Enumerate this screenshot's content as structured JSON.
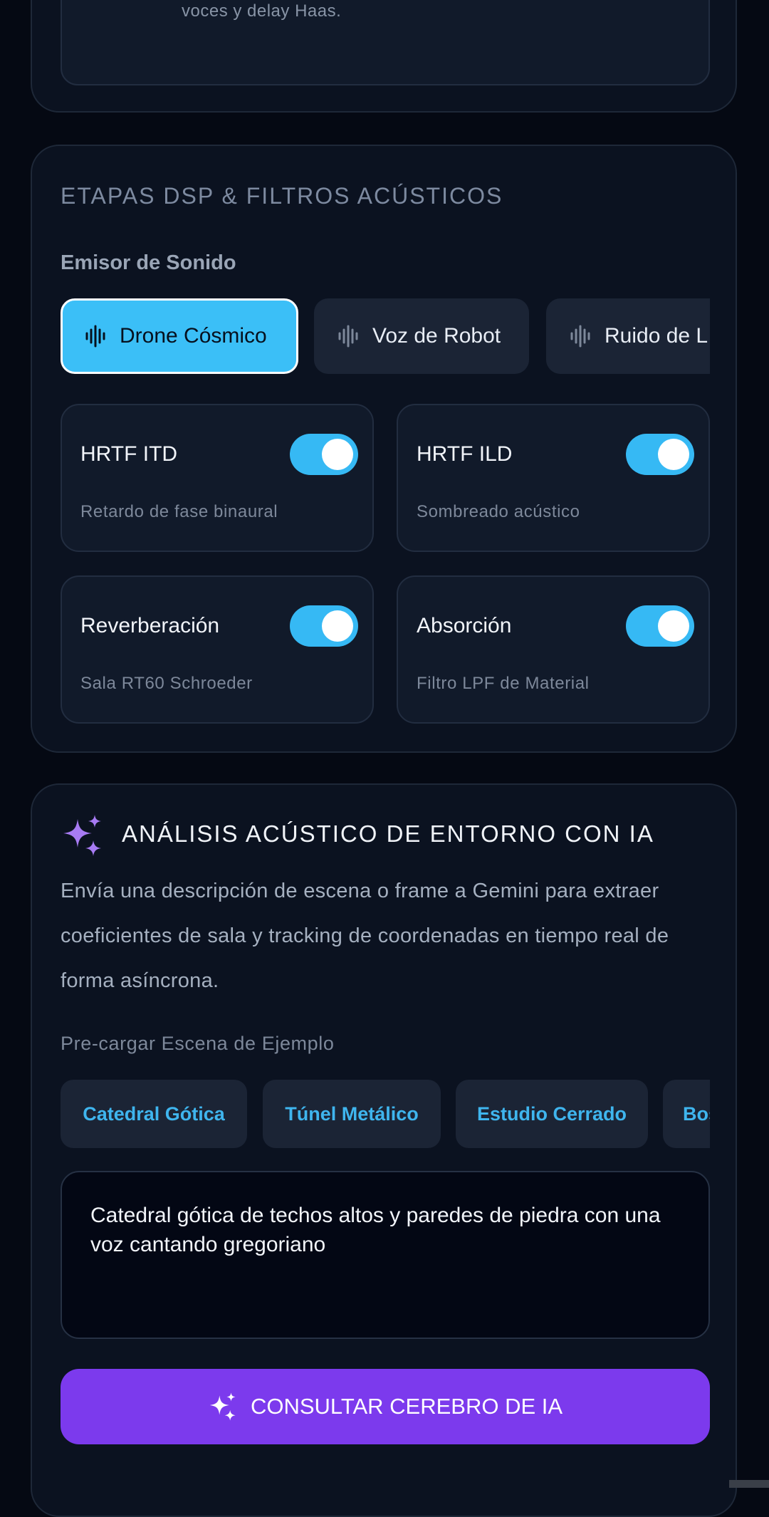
{
  "top_card": {
    "text": "voces y delay Haas."
  },
  "dsp": {
    "title": "ETAPAS DSP & FILTROS ACÚSTICOS",
    "emitter_label": "Emisor de Sonido",
    "emitters": [
      "Drone Cósmico",
      "Voz de Robot",
      "Ruido de L"
    ],
    "active_emitter": "Drone Cósmico",
    "toggles": [
      {
        "title": "HRTF ITD",
        "subtitle": "Retardo de fase binaural",
        "on": true
      },
      {
        "title": "HRTF ILD",
        "subtitle": "Sombreado acústico",
        "on": true
      },
      {
        "title": "Reverberación",
        "subtitle": "Sala RT60 Schroeder",
        "on": true
      },
      {
        "title": "Absorción",
        "subtitle": "Filtro LPF de Material",
        "on": true
      }
    ]
  },
  "ai": {
    "title": "ANÁLISIS ACÚSTICO DE ENTORNO CON IA",
    "description": "Envía una descripción de escena o frame a Gemini para extraer coeficientes de sala y tracking de coordenadas en tiempo real de forma asíncrona.",
    "preset_label": "Pre-cargar Escena de Ejemplo",
    "presets": [
      "Catedral Gótica",
      "Túnel Metálico",
      "Estudio Cerrado",
      "Bos"
    ],
    "scene_text": "Catedral gótica de techos altos y paredes de piedra con una voz cantando gregoriano",
    "consult_label": "CONSULTAR CEREBRO DE IA"
  },
  "colors": {
    "accent_blue": "#3bbff7",
    "accent_purple": "#7c3aed",
    "card_bg": "#0b1220"
  },
  "icons": {
    "emitter": "waveform-icon",
    "ai": "sparkles-icon"
  }
}
